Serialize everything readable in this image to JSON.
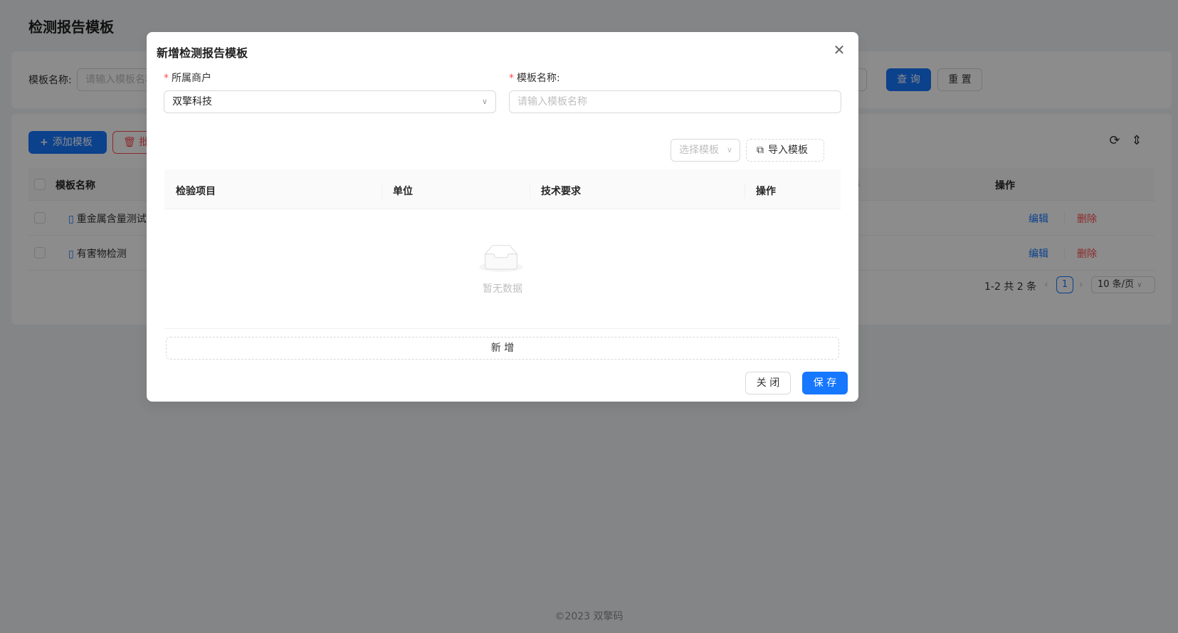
{
  "page": {
    "title": "检测报告模板",
    "footer": "©2023 双擎码"
  },
  "search": {
    "label": "模板名称:",
    "placeholder": "请输入模板名称",
    "query_label": "查 询",
    "reset_label": "重 置"
  },
  "toolbar": {
    "add_label": "添加模板",
    "batch_label": "批",
    "refresh_icon": "refresh-icon",
    "density_icon": "column-height-icon"
  },
  "table": {
    "columns": [
      "模板名称",
      "操作"
    ],
    "rows": [
      {
        "name": "重金属含量测试模",
        "edit": "编辑",
        "delete": "删除"
      },
      {
        "name": "有害物检测",
        "edit": "编辑",
        "delete": "删除"
      }
    ]
  },
  "pagination": {
    "total_text": "1-2 共 2 条",
    "current": "1",
    "page_size": "10 条/页"
  },
  "modal": {
    "title": "新增检测报告模板",
    "merchant_label": "所属商户",
    "merchant_value": "双擎科技",
    "name_label": "模板名称:",
    "name_placeholder": "请输入模板名称",
    "select_template": "选择模板",
    "import_template": "导入模板",
    "columns": [
      "检验项目",
      "单位",
      "技术要求",
      "操作"
    ],
    "empty_text": "暂无数据",
    "add_row": "新 增",
    "close": "关 闭",
    "save": "保 存"
  },
  "colors": {
    "primary": "#1677ff",
    "danger": "#ff4d4f",
    "mask": "rgba(0,0,0,0.45)"
  }
}
